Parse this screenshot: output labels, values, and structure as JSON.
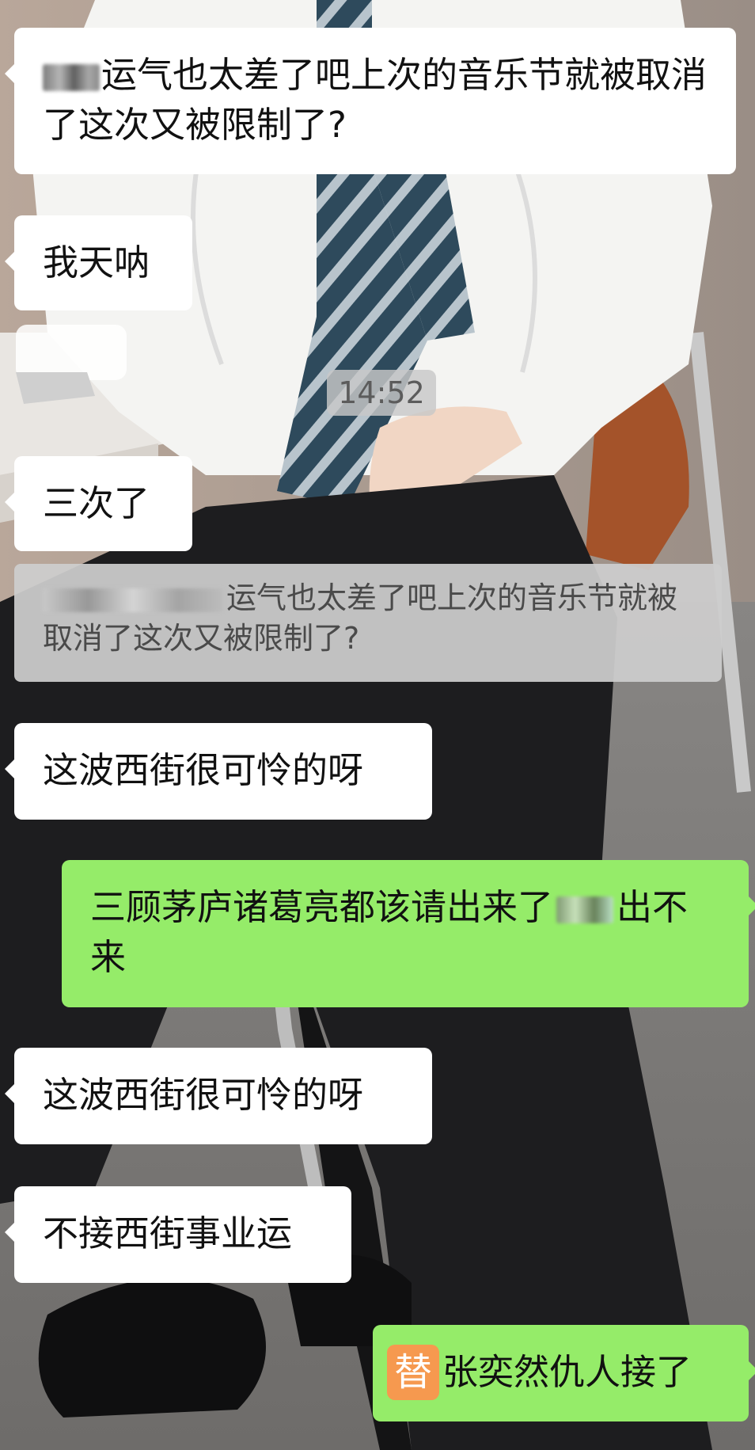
{
  "chat": {
    "timestamp": "14:52",
    "messages": [
      {
        "direction": "incoming",
        "text": "运气也太差了吧上次的音乐节就被取消了这次又被限制了?"
      },
      {
        "direction": "incoming",
        "text": "我天呐"
      },
      {
        "direction": "incoming",
        "text": "三次了"
      },
      {
        "direction": "incoming_quote",
        "text": "运气也太差了吧上次的音乐节就被取消了这次又被限制了?"
      },
      {
        "direction": "incoming",
        "text": "这波西街很可怜的呀"
      },
      {
        "direction": "outgoing",
        "text_before": "三顾茅庐诸葛亮都该请出来了",
        "text_after": "出不来"
      },
      {
        "direction": "incoming",
        "text": "这波西街很可怜的呀"
      },
      {
        "direction": "incoming",
        "text": "不接西街事业运"
      },
      {
        "direction": "outgoing",
        "badge": "替",
        "text": "张奕然仇人接了"
      }
    ]
  },
  "colors": {
    "incoming_bubble": "#ffffff",
    "outgoing_bubble": "#95ec69",
    "quote_bubble": "#cdcdcd",
    "badge": "#f6994f"
  }
}
